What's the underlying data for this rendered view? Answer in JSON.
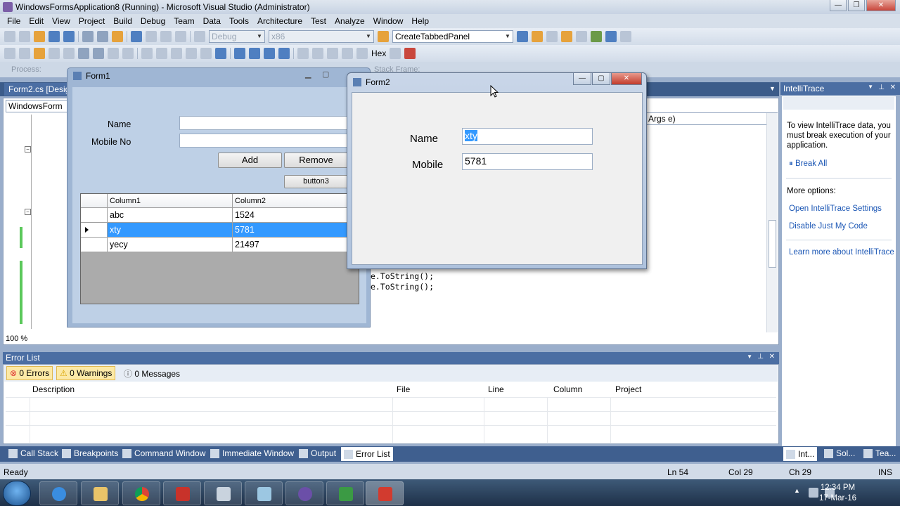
{
  "vs": {
    "title": "WindowsFormsApplication8 (Running) - Microsoft Visual Studio (Administrator)",
    "menu": [
      "File",
      "Edit",
      "View",
      "Project",
      "Build",
      "Debug",
      "Team",
      "Data",
      "Tools",
      "Architecture",
      "Test",
      "Analyze",
      "Window",
      "Help"
    ],
    "toolbar": {
      "config": "Debug",
      "platform": "x86",
      "find_combo": "CreateTabbedPanel",
      "hex_label": "Hex"
    },
    "process_label": "Process:",
    "stack_frame_label": "Stack Frame:",
    "doc_tab": "Form2.cs [Design",
    "nav_left": "WindowsForm",
    "nav_right": "Args e)",
    "code_lines": [
      "e.ToString();",
      "e.ToString();"
    ],
    "zoom": "100 %"
  },
  "form1": {
    "title": "Form1",
    "name_label": "Name",
    "mobile_label": "Mobile No",
    "add_button": "Add",
    "remove_button": "Remove",
    "button3": "button3",
    "grid": {
      "columns": [
        "Column1",
        "Column2"
      ],
      "rows": [
        {
          "c1": "abc",
          "c2": "1524"
        },
        {
          "c1": "xty",
          "c2": "5781"
        },
        {
          "c1": "yecy",
          "c2": "21497"
        }
      ],
      "selected_row": 1
    }
  },
  "form2": {
    "title": "Form2",
    "name_label": "Name",
    "name_value": "xty",
    "mobile_label": "Mobile",
    "mobile_value": "5781"
  },
  "intellitrace": {
    "title": "IntelliTrace",
    "info": [
      "To view IntelliTrace data, you",
      "must break execution of your",
      "application."
    ],
    "break_all": "Break All",
    "more_options": "More options:",
    "links": [
      "Open IntelliTrace Settings",
      "Disable Just My Code",
      "Learn more about IntelliTrace"
    ]
  },
  "error_list": {
    "title": "Error List",
    "errors": "0 Errors",
    "warnings": "0 Warnings",
    "messages": "0 Messages",
    "columns": [
      "Description",
      "File",
      "Line",
      "Column",
      "Project"
    ]
  },
  "bottom_tabs": [
    "Call Stack",
    "Breakpoints",
    "Command Window",
    "Immediate Window",
    "Output",
    "Error List"
  ],
  "right_tabs": [
    "Int...",
    "Sol...",
    "Tea..."
  ],
  "status": {
    "state": "Ready",
    "ln": "Ln 54",
    "col": "Col 29",
    "ch": "Ch 29",
    "mode": "INS"
  },
  "taskbar": {
    "time": "12:34 PM",
    "date": "17-Mar-16"
  }
}
